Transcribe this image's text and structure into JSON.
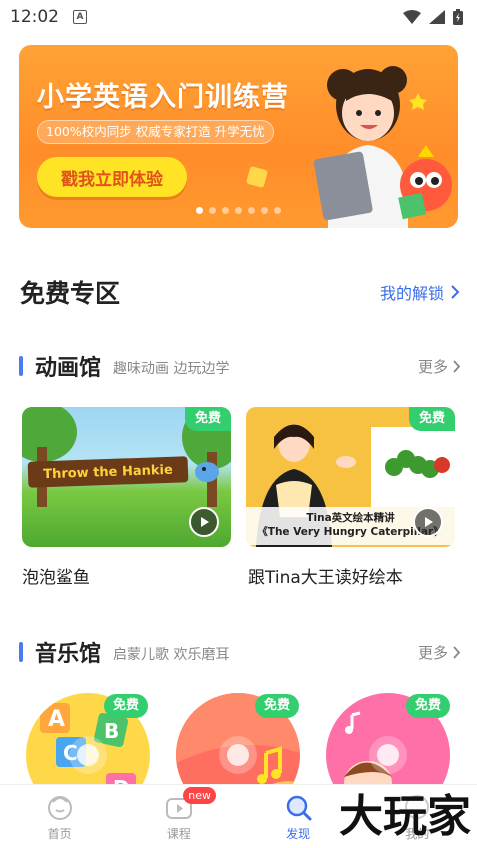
{
  "status": {
    "time": "12:02",
    "notif": "A"
  },
  "banner": {
    "title": "小学英语入门训练营",
    "subtitle": "100%校内同步  权威专家打造  升学无忧",
    "cta": "戳我立即体验",
    "dots": 7,
    "active_dot": 0
  },
  "free_zone": {
    "title": "免费专区",
    "link": "我的解锁"
  },
  "animation": {
    "title": "动画馆",
    "desc": "趣味动画 边玩边学",
    "more": "更多",
    "cards": [
      {
        "tag": "免费",
        "title": "泡泡鲨鱼",
        "art_text": "Throw the Hankie"
      },
      {
        "tag": "免费",
        "title": "跟Tina大王读好绘本",
        "caption1": "Tina英文绘本精讲",
        "caption2": "《The Very Hungry Caterpillar》"
      }
    ]
  },
  "music": {
    "title": "音乐馆",
    "desc": "启蒙儿歌 欢乐磨耳",
    "more": "更多",
    "discs": [
      {
        "tag": "免费",
        "color": "#ffd84a"
      },
      {
        "tag": "免费",
        "color": "#ff6f61"
      },
      {
        "tag": "免费",
        "color": "#ff6fa8"
      }
    ]
  },
  "nav": {
    "items": [
      {
        "label": "首页"
      },
      {
        "label": "课程",
        "badge": "new"
      },
      {
        "label": "发现"
      },
      {
        "label": "我的"
      }
    ],
    "active": 2
  },
  "watermark": "大玩家",
  "colors": {
    "accent": "#3a6ee8",
    "free_tag": "#33cf6f",
    "banner": "#ff9a2f"
  }
}
